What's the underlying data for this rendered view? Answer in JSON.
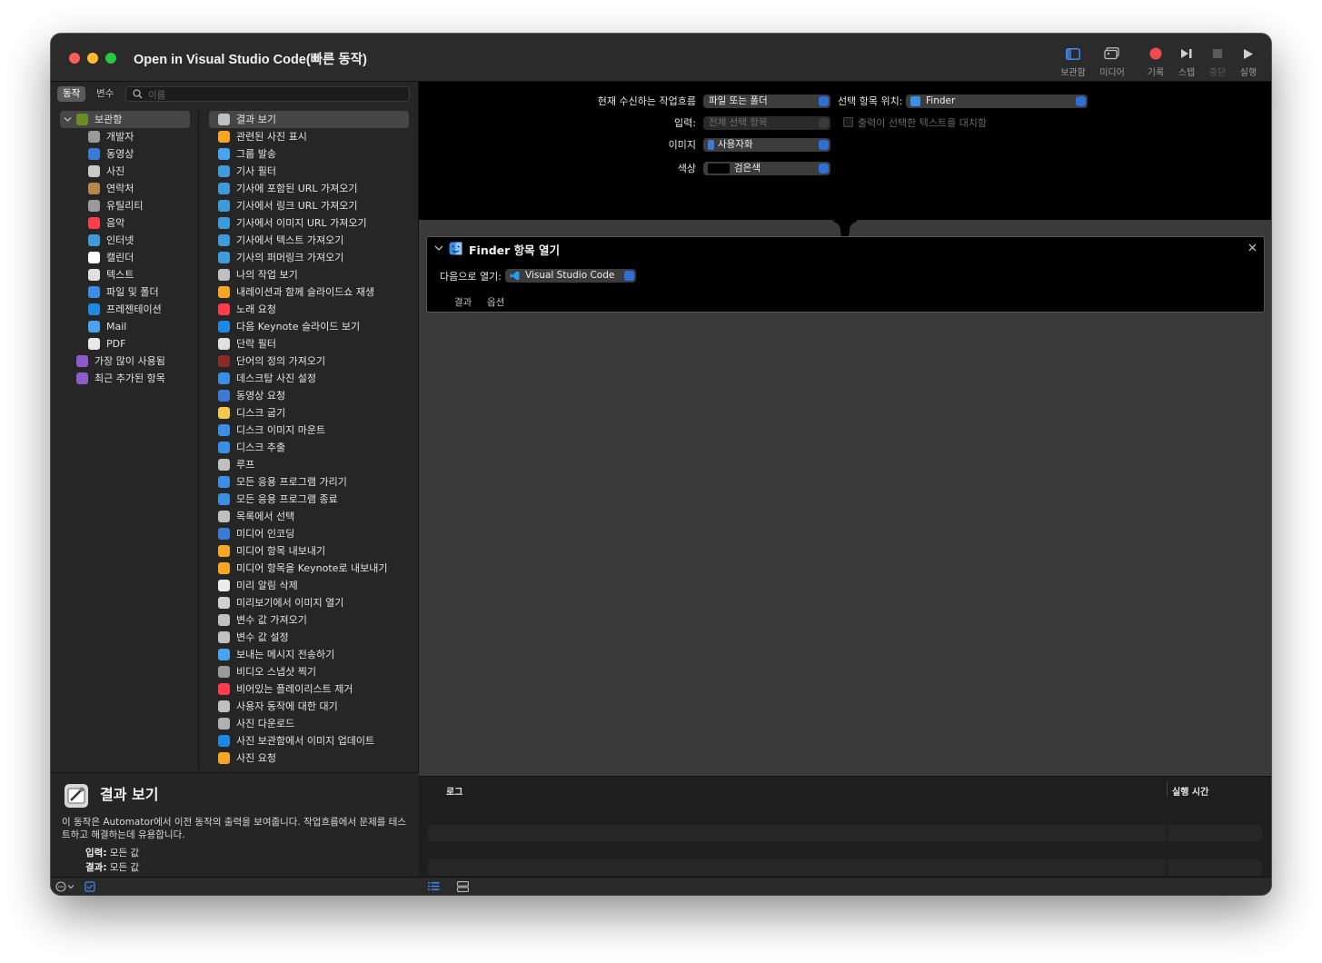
{
  "window": {
    "title": "Open in Visual Studio Code(빠른 동작)"
  },
  "toolbar": [
    {
      "label": "보관함",
      "icon": "sidebar-icon",
      "enabled": true
    },
    {
      "label": "미디어",
      "icon": "media-icon",
      "enabled": true
    },
    {
      "label": "기록",
      "icon": "record-icon",
      "enabled": true
    },
    {
      "label": "스텝",
      "icon": "step-icon",
      "enabled": true
    },
    {
      "label": "중단",
      "icon": "stop-icon",
      "enabled": false
    },
    {
      "label": "실행",
      "icon": "run-icon",
      "enabled": true
    }
  ],
  "left": {
    "tab_actions": "동작",
    "tab_variables": "변수",
    "search_placeholder": "이름",
    "library": [
      {
        "label": "보관함",
        "icon": "library-icon",
        "color": "#6b8e23",
        "selected": true,
        "root": true
      },
      {
        "label": "개발자",
        "icon": "tools-icon",
        "color": "#9a9a9a"
      },
      {
        "label": "동영상",
        "icon": "quicktime-icon",
        "color": "#3a7bd5"
      },
      {
        "label": "사진",
        "icon": "photo-icon",
        "color": "#c9c9c9"
      },
      {
        "label": "연락처",
        "icon": "contacts-icon",
        "color": "#b8864b"
      },
      {
        "label": "유틸리티",
        "icon": "tools-icon",
        "color": "#9a9a9a"
      },
      {
        "label": "음악",
        "icon": "music-icon",
        "color": "#fa3c4c"
      },
      {
        "label": "인터넷",
        "icon": "globe-icon",
        "color": "#3d9bdc"
      },
      {
        "label": "캘린더",
        "icon": "calendar-icon",
        "color": "#ffffff"
      },
      {
        "label": "텍스트",
        "icon": "text-icon",
        "color": "#e0e0e0"
      },
      {
        "label": "파일 및 폴더",
        "icon": "finder-icon",
        "color": "#3a8ee6"
      },
      {
        "label": "프레젠테이션",
        "icon": "keynote-icon",
        "color": "#1e88e5"
      },
      {
        "label": "Mail",
        "icon": "mail-icon",
        "color": "#4aa3f0"
      },
      {
        "label": "PDF",
        "icon": "pdf-icon",
        "color": "#e8e8e8"
      },
      {
        "label": "가장 많이 사용됨",
        "icon": "smart-folder-icon",
        "color": "#8e5cc9",
        "root": true
      },
      {
        "label": "최근 추가된 항목",
        "icon": "smart-folder-icon",
        "color": "#8e5cc9",
        "root": true
      }
    ],
    "actions": [
      {
        "label": "결과 보기",
        "icon": "automator-icon",
        "color": "#c0c0c0",
        "selected": true
      },
      {
        "label": "관련된 사진 표시",
        "icon": "photos-icon",
        "color": "#f6a623"
      },
      {
        "label": "그룹 발송",
        "icon": "mail-icon",
        "color": "#4aa3f0"
      },
      {
        "label": "기사 필터",
        "icon": "safari-icon",
        "color": "#3d9bdc"
      },
      {
        "label": "기사에 포함된 URL 가져오기",
        "icon": "safari-icon",
        "color": "#3d9bdc"
      },
      {
        "label": "기사에서 링크 URL 가져오기",
        "icon": "safari-icon",
        "color": "#3d9bdc"
      },
      {
        "label": "기사에서 이미지 URL 가져오기",
        "icon": "safari-icon",
        "color": "#3d9bdc"
      },
      {
        "label": "기사에서 텍스트 가져오기",
        "icon": "safari-icon",
        "color": "#3d9bdc"
      },
      {
        "label": "기사의 퍼머링크 가져오기",
        "icon": "safari-icon",
        "color": "#3d9bdc"
      },
      {
        "label": "나의 작업 보기",
        "icon": "automator-icon",
        "color": "#c0c0c0"
      },
      {
        "label": "내레이션과 함께 슬라이드쇼 재생",
        "icon": "photos-icon",
        "color": "#f6a623"
      },
      {
        "label": "노래 요청",
        "icon": "music-icon",
        "color": "#fa3c4c"
      },
      {
        "label": "다음 Keynote 슬라이드 보기",
        "icon": "keynote-icon",
        "color": "#1e88e5"
      },
      {
        "label": "단락 필터",
        "icon": "text-icon",
        "color": "#e0e0e0"
      },
      {
        "label": "단어의 정의 가져오기",
        "icon": "dictionary-icon",
        "color": "#8b2a2a"
      },
      {
        "label": "데스크탑 사진 설정",
        "icon": "finder-icon",
        "color": "#3a8ee6"
      },
      {
        "label": "동영상 요청",
        "icon": "quicktime-icon",
        "color": "#3a7bd5"
      },
      {
        "label": "디스크 굽기",
        "icon": "burn-icon",
        "color": "#f2c94c"
      },
      {
        "label": "디스크 이미지 마운트",
        "icon": "finder-icon",
        "color": "#3a8ee6"
      },
      {
        "label": "디스크 추출",
        "icon": "finder-icon",
        "color": "#3a8ee6"
      },
      {
        "label": "루프",
        "icon": "automator-icon",
        "color": "#c0c0c0"
      },
      {
        "label": "모든 응용 프로그램 가리기",
        "icon": "finder-icon",
        "color": "#3a8ee6"
      },
      {
        "label": "모든 응용 프로그램 종료",
        "icon": "finder-icon",
        "color": "#3a8ee6"
      },
      {
        "label": "목록에서 선택",
        "icon": "automator-icon",
        "color": "#c0c0c0"
      },
      {
        "label": "미디어 인코딩",
        "icon": "quicktime-icon",
        "color": "#3a7bd5"
      },
      {
        "label": "미디어 항목 내보내기",
        "icon": "photos-icon",
        "color": "#f6a623"
      },
      {
        "label": "미디어 항목을 Keynote로 내보내기",
        "icon": "photos-icon",
        "color": "#f6a623"
      },
      {
        "label": "미리 알림 삭제",
        "icon": "reminders-icon",
        "color": "#ececec"
      },
      {
        "label": "미리보기에서 이미지 열기",
        "icon": "preview-icon",
        "color": "#d0d0d0"
      },
      {
        "label": "변수 값 가져오기",
        "icon": "automator-icon",
        "color": "#c0c0c0"
      },
      {
        "label": "변수 값 설정",
        "icon": "automator-icon",
        "color": "#c0c0c0"
      },
      {
        "label": "보내는 메시지 전송하기",
        "icon": "mail-icon",
        "color": "#4aa3f0"
      },
      {
        "label": "비디오 스냅샷 찍기",
        "icon": "tools-icon",
        "color": "#9a9a9a"
      },
      {
        "label": "비어있는 플레이리스트 제거",
        "icon": "music-icon",
        "color": "#fa3c4c"
      },
      {
        "label": "사용자 동작에 대한 대기",
        "icon": "automator-icon",
        "color": "#c0c0c0"
      },
      {
        "label": "사진 다운로드",
        "icon": "image-capture-icon",
        "color": "#b0b0b0"
      },
      {
        "label": "사진 보관함에서 이미지 업데이트",
        "icon": "keynote-icon",
        "color": "#1e88e5"
      },
      {
        "label": "사진 요청",
        "icon": "photos-icon",
        "color": "#f6a623"
      }
    ],
    "description": {
      "title": "결과 보기",
      "text": "이 동작은 Automator에서 이전 동작의 출력을 보여줍니다. 작업흐름에서 문제를 테스트하고 해결하는데 유용합니다.",
      "input_label": "입력:",
      "input_value": "모든 값",
      "result_label": "결과:",
      "result_value": "모든 값"
    }
  },
  "config": {
    "receives_label": "현재 수신하는 작업흐름",
    "receives_value": "파일 또는 폴더",
    "location_label": "선택 항목 위치:",
    "location_value": "Finder",
    "input_label": "입력:",
    "input_value": "전체 선택 항목",
    "replace_label": "출력이 선택한 텍스트를 대치함",
    "image_label": "이미지",
    "image_value": "사용자화",
    "color_label": "색상",
    "color_value": "검은색"
  },
  "action_card": {
    "title": "Finder 항목 열기",
    "open_with_label": "다음으로 열기:",
    "open_with_value": "Visual Studio Code",
    "tab_results": "결과",
    "tab_options": "옵션"
  },
  "log": {
    "col_log": "로그",
    "col_time": "실행 시간"
  }
}
